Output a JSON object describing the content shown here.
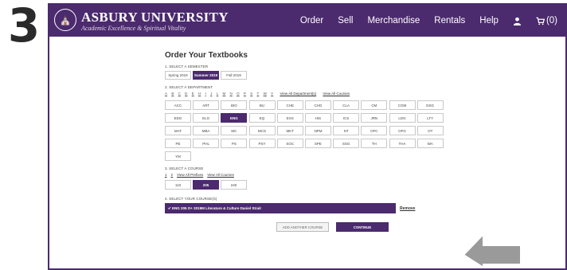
{
  "step_number": "3",
  "brand": {
    "name": "ASBURY UNIVERSITY",
    "tagline": "Academic Excellence & Spiritual Vitality",
    "logo_icon": "university-seal-icon"
  },
  "nav": {
    "items": [
      "Order",
      "Sell",
      "Merchandise",
      "Rentals",
      "Help"
    ],
    "user_icon": "user-icon",
    "cart_icon": "cart-icon",
    "cart_count": "(0)"
  },
  "page_title": "Order Your Textbooks",
  "semester": {
    "label": "1. SELECT A SEMESTER",
    "options": [
      "Spring 2019",
      "Summer 2019",
      "Fall 2019"
    ],
    "selected": "Summer 2019"
  },
  "department": {
    "label": "2. SELECT A DEPARTMENT",
    "letters": [
      "A",
      "B",
      "C",
      "D",
      "E",
      "H",
      "I",
      "J",
      "L",
      "M",
      "N",
      "O",
      "P",
      "S",
      "T",
      "W",
      "Y"
    ],
    "view_all_departments": "View All Department(s)",
    "view_all_courses": "View All Courses",
    "options": [
      "ACC",
      "ART",
      "BIO",
      "BU",
      "CHE",
      "CHG",
      "CLA",
      "CM",
      "COM",
      "DSG",
      "EDG",
      "ELG",
      "ENG",
      "EQ",
      "EXS",
      "HIS",
      "ICS",
      "JRN",
      "LDG",
      "LTY",
      "MAT",
      "MBA",
      "MC",
      "MCG",
      "MKT",
      "NPM",
      "NT",
      "OFC",
      "OFG",
      "OT",
      "PE",
      "PHL",
      "PS",
      "PSY",
      "SOC",
      "SPE",
      "SSG",
      "TH",
      "THA",
      "WA",
      "YM"
    ],
    "selected": "ENG"
  },
  "course": {
    "label": "3. SELECT A COURSE",
    "links": [
      "1",
      "2",
      "View All Prefixes",
      "View All Courses"
    ],
    "options": [
      "110",
      "205",
      "240"
    ],
    "selected": "205"
  },
  "your_courses": {
    "label": "4. SELECT YOUR COURSE(S)",
    "selected_text": "✔ ENG 205 O+ 2019M Literature & Culture Daniel Strait",
    "remove_label": "Remove"
  },
  "actions": {
    "add_another": "ADD ANOTHER COURSE",
    "continue": "CONTINUE"
  },
  "colors": {
    "brand_purple": "#4b2a6e",
    "arrow_gray": "#9a9a9a"
  }
}
